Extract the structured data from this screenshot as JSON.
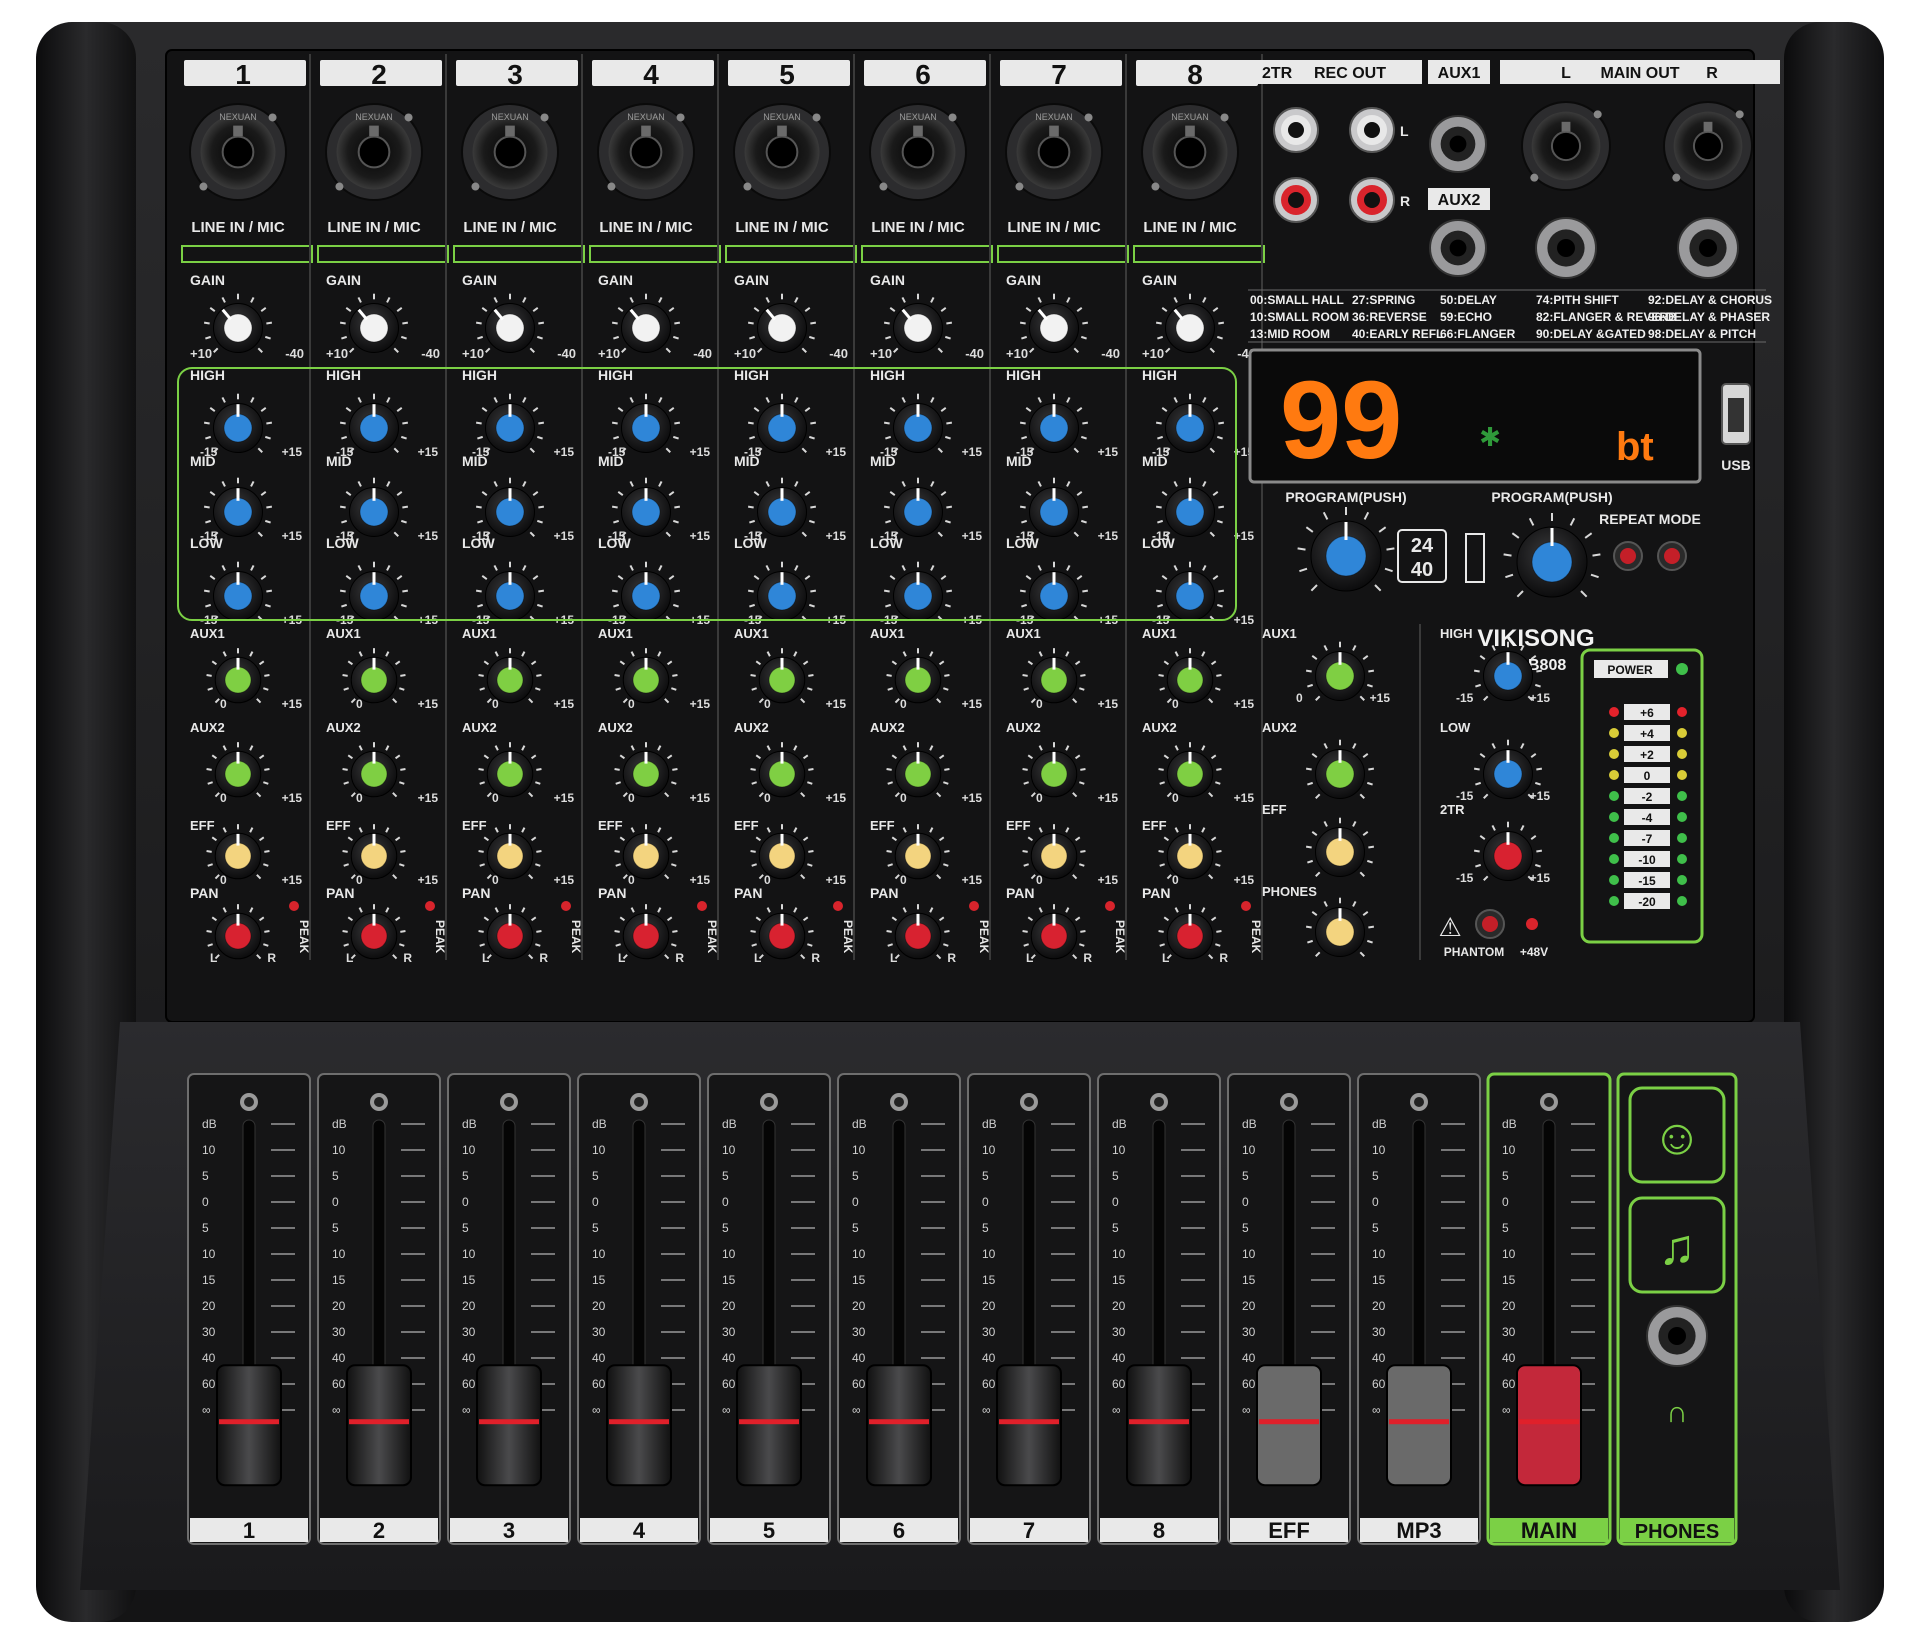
{
  "channels": [
    {
      "number": "1",
      "jack_label": "LINE IN / MIC",
      "brand_print": "NEXUAN",
      "fader_label": "1",
      "fader_level": 0.12
    },
    {
      "number": "2",
      "jack_label": "LINE IN / MIC",
      "brand_print": "NEXUAN",
      "fader_label": "2",
      "fader_level": 0.12
    },
    {
      "number": "3",
      "jack_label": "LINE IN / MIC",
      "brand_print": "NEXUAN",
      "fader_label": "3",
      "fader_level": 0.12
    },
    {
      "number": "4",
      "jack_label": "LINE IN / MIC",
      "brand_print": "NEXUAN",
      "fader_label": "4",
      "fader_level": 0.12
    },
    {
      "number": "5",
      "jack_label": "LINE IN / MIC",
      "brand_print": "NEXUAN",
      "fader_label": "5",
      "fader_level": 0.12
    },
    {
      "number": "6",
      "jack_label": "LINE IN / MIC",
      "brand_print": "NEXUAN",
      "fader_label": "6",
      "fader_level": 0.12
    },
    {
      "number": "7",
      "jack_label": "LINE IN / MIC",
      "brand_print": "NEXUAN",
      "fader_label": "7",
      "fader_level": 0.12
    },
    {
      "number": "8",
      "jack_label": "LINE IN / MIC",
      "brand_print": "NEXUAN",
      "fader_label": "8",
      "fader_level": 0.12
    }
  ],
  "channel_strip": {
    "gain": "GAIN",
    "gain_min": "+10",
    "gain_max": "-40",
    "high": "HIGH",
    "mid": "MID",
    "low": "LOW",
    "eq_min": "-15",
    "eq_max": "+15",
    "aux1": "AUX1",
    "aux2": "AUX2",
    "eff": "EFF",
    "send_min": "0",
    "send_max": "+15",
    "pan": "PAN",
    "pan_l": "L",
    "pan_r": "R",
    "peak": "PEAK"
  },
  "rear_panel": {
    "twotr": "2TR",
    "rec_out": "REC OUT",
    "l": "L",
    "r": "R",
    "aux1": "AUX1",
    "aux2": "AUX2",
    "main_out": "MAIN OUT",
    "main_l": "L",
    "main_r": "R"
  },
  "effects_list": [
    [
      "00:SMALL HALL",
      "27:SPRING",
      "50:DELAY",
      "74:PITH SHIFT",
      "92:DELAY & CHORUS"
    ],
    [
      "10:SMALL ROOM",
      "36:REVERSE",
      "59:ECHO",
      "82:FLANGER & REVERB",
      "96:DELAY & PHASER"
    ],
    [
      "13:MID ROOM",
      "40:EARLY REFL",
      "66:FLANGER",
      "90:DELAY &GATED",
      "98:DELAY & PITCH"
    ]
  ],
  "display": {
    "program_number": "99",
    "status_text": "bt",
    "bluetooth_icon": "bluetooth-icon"
  },
  "usb_label": "USB",
  "program_left": {
    "label": "PROGRAM(PUSH)",
    "badge_top": "24",
    "badge_bottom": "40"
  },
  "program_right": {
    "label": "PROGRAM(PUSH)"
  },
  "repeat_mode": "REPEAT MODE",
  "brand": {
    "name": "VIKISONG",
    "model": "GLB808"
  },
  "master_section": {
    "aux1": "AUX1",
    "aux2": "AUX2",
    "eff": "EFF",
    "phones": "PHONES",
    "send_min": "0",
    "send_max": "+15",
    "high": "HIGH",
    "low": "LOW",
    "twotr": "2TR",
    "eq_min": "-15",
    "eq_max": "+15",
    "phantom": "PHANTOM",
    "plus48v": "+48V"
  },
  "meter": {
    "power": "POWER",
    "levels": [
      "+6",
      "+4",
      "+2",
      "0",
      "-2",
      "-4",
      "-7",
      "-10",
      "-15",
      "-20"
    ],
    "led_colors": [
      "#e3222b",
      "#d9cc37",
      "#d9cc37",
      "#d9cc37",
      "#3fbf4a",
      "#3fbf4a",
      "#3fbf4a",
      "#3fbf4a",
      "#3fbf4a",
      "#3fbf4a"
    ]
  },
  "fader_scale": [
    "dB",
    "10",
    "5",
    "0",
    "5",
    "10",
    "15",
    "20",
    "30",
    "40",
    "60",
    "∞"
  ],
  "extra_faders": [
    {
      "label": "EFF",
      "cap_color": "#6a6a6a",
      "fader_level": 0.12
    },
    {
      "label": "MP3",
      "cap_color": "#6a6a6a",
      "fader_level": 0.12
    },
    {
      "label": "MAIN",
      "cap_color": "#c3283a",
      "fader_level": 0.12
    }
  ],
  "phones_label": "PHONES",
  "colors": {
    "body": "#1d1d1f",
    "panel": "#121213",
    "accent_green": "#7bd045",
    "eq_knob": "#2f86d8",
    "aux_knob": "#7fcf43",
    "eff_knob": "#f3d47f",
    "pan_knob": "#d82230",
    "display_digits": "#ff7a10"
  }
}
